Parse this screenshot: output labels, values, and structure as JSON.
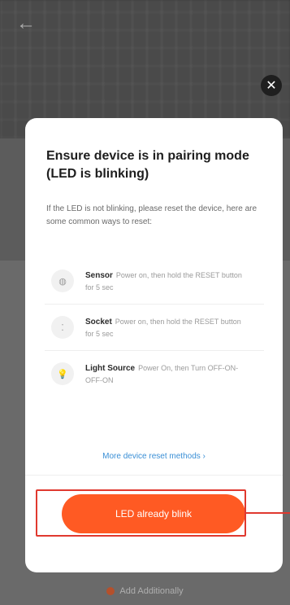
{
  "background": {
    "back_icon": "arrow-left-icon",
    "bottom_link_label": "Add Additionally"
  },
  "modal": {
    "close_icon": "close-icon",
    "title": "Ensure device is in pairing mode (LED is blinking)",
    "description": "If the LED is not blinking, please reset the device, here are some common ways to reset:",
    "methods": [
      {
        "icon": "sensor-icon",
        "name": "Sensor",
        "text": "Power on, then hold the RESET button for 5 sec"
      },
      {
        "icon": "socket-icon",
        "name": "Socket",
        "text": "Power on, then hold the RESET button for 5 sec"
      },
      {
        "icon": "light-bulb-icon",
        "name": "Light Source",
        "text": "Power On, then Turn OFF-ON-OFF-ON"
      }
    ],
    "more_link": "More device reset methods ›",
    "primary_button": "LED already blink"
  },
  "colors": {
    "accent": "#ff5a23",
    "link": "#3a8fd6",
    "highlight": "#e0392f"
  }
}
